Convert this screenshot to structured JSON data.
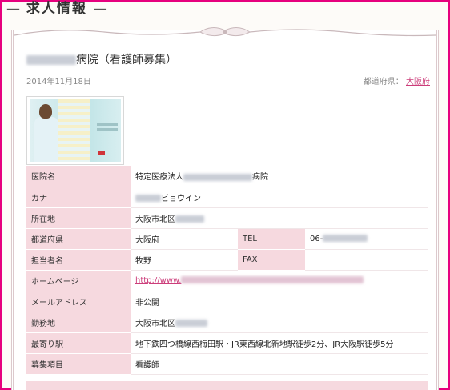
{
  "section": {
    "title": "求人情報",
    "dash": "—"
  },
  "job": {
    "title_suffix": "病院（看護師募集）",
    "date": "2014年11月18日",
    "prefecture_label": "都道府県：",
    "prefecture_link": "大阪府"
  },
  "rows": [
    {
      "label": "医院名",
      "prefix": "特定医療法人",
      "suffix": "病院"
    },
    {
      "label": "カナ",
      "suffix": "ビョウイン"
    },
    {
      "label": "所在地",
      "prefix": "大阪市北区"
    },
    {
      "label": "都道府県",
      "value": "大阪府",
      "label2": "TEL",
      "value2": "06-"
    },
    {
      "label": "担当者名",
      "value": "牧野",
      "label2": "FAX",
      "value2": ""
    },
    {
      "label": "ホームページ",
      "url_prefix": "http://www."
    },
    {
      "label": "メールアドレス",
      "value": "非公開"
    },
    {
      "label": "勤務地",
      "prefix": "大阪市北区"
    },
    {
      "label": "最寄り駅",
      "value": "地下鉄四つ橋線西梅田駅・JR東西線北新地駅徒歩2分、JR大阪駅徒歩5分"
    },
    {
      "label": "募集項目",
      "value": "看護師"
    }
  ],
  "colors": {
    "frame": "#e6007e",
    "label_bg": "#f6d9df",
    "link": "#cc3d7a"
  }
}
